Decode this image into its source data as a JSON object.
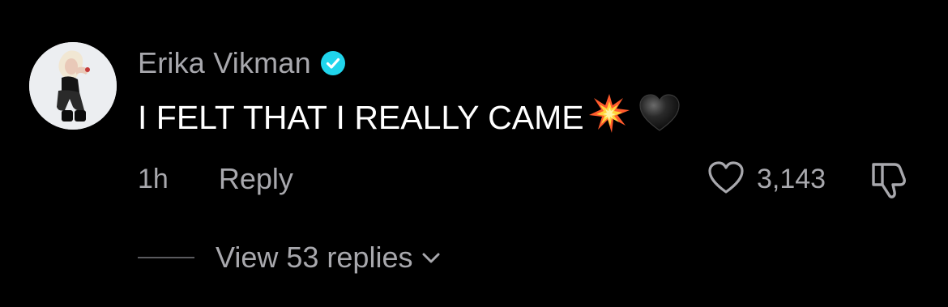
{
  "comment": {
    "author": "Erika Vikman",
    "verified": true,
    "text": "I FELT THAT I REALLY CAME",
    "emojis": [
      "collision",
      "black-heart"
    ],
    "time": "1h",
    "reply_label": "Reply",
    "like_count": "3,143",
    "view_replies_label": "View 53 replies"
  },
  "colors": {
    "background": "#000000",
    "primary_text": "#ffffff",
    "secondary_text": "#a8a8ad",
    "verified_badge": "#20d5ec"
  }
}
